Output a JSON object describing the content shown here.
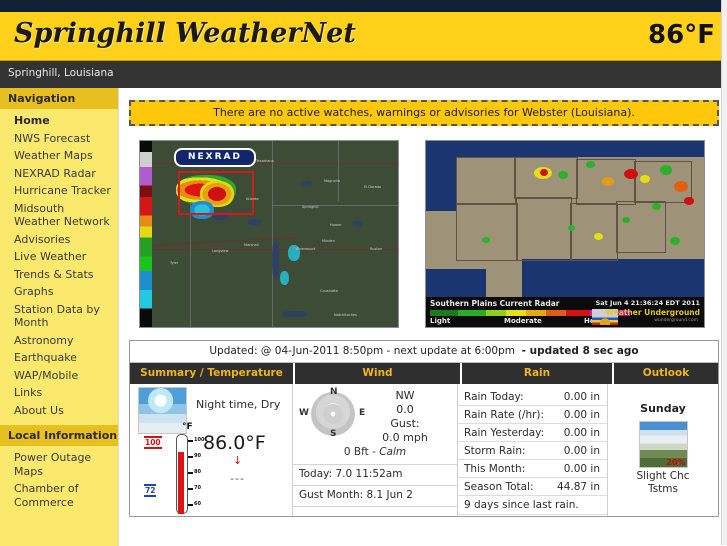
{
  "header": {
    "site_title": "Springhill WeatherNet",
    "current_temp": "86°F",
    "location": "Springhill, Louisiana"
  },
  "sidebar": {
    "nav_heading": "Navigation",
    "items": [
      {
        "label": "Home",
        "active": true
      },
      {
        "label": "NWS Forecast",
        "active": false
      },
      {
        "label": "Weather Maps",
        "active": false
      },
      {
        "label": "NEXRAD Radar",
        "active": false
      },
      {
        "label": "Hurricane Tracker",
        "active": false
      },
      {
        "label": "Midsouth Weather Network",
        "active": false
      },
      {
        "label": "Advisories",
        "active": false
      },
      {
        "label": "Live Weather",
        "active": false
      },
      {
        "label": "Trends & Stats",
        "active": false
      },
      {
        "label": "Graphs",
        "active": false
      },
      {
        "label": "Station Data by Month",
        "active": false
      },
      {
        "label": "Astronomy",
        "active": false
      },
      {
        "label": "Earthquake",
        "active": false
      },
      {
        "label": "WAP/Mobile",
        "active": false
      },
      {
        "label": "Links",
        "active": false
      },
      {
        "label": "About Us",
        "active": false
      }
    ],
    "local_heading": "Local Information",
    "local_items": [
      {
        "label": "Power Outage Maps"
      },
      {
        "label": "Chamber of Commerce"
      }
    ]
  },
  "alert": {
    "text": "There are no active watches, warnings or advisories for Webster (Louisiana)."
  },
  "radar_left": {
    "logo": "NEXRAD",
    "cities": [
      "Texarkana",
      "Magnolia",
      "El Dorado",
      "Atlanta",
      "Springhill",
      "Homer",
      "Minden",
      "Ruston",
      "Longview",
      "Marshall",
      "Shreveport",
      "Coushatta",
      "Tyler",
      "Natchitoches"
    ]
  },
  "radar_right": {
    "title": "Southern Plains Current Radar",
    "timestamp": "Sat Jun  4 21:36:24 EDT 2011",
    "brand": "Weather Underground",
    "brand_sub": "wunderground.com",
    "legend": [
      "Light",
      "Moderate",
      "Heavy"
    ]
  },
  "dashboard": {
    "updated_prefix": "Updated: @ 04-Jun-2011 8:50pm - next update at 6:00pm",
    "updated_suffix": "- updated 8 sec ago",
    "headers": {
      "summary": "Summary / Temperature",
      "wind": "Wind",
      "rain": "Rain",
      "outlook": "Outlook"
    },
    "summary": {
      "condition": "Night time, Dry",
      "temperature": "86.0°F",
      "trend_arrow": "↓",
      "dewpoint_placeholder": "---",
      "thermometer": {
        "unit": "°F",
        "high": "100",
        "low": "72",
        "ticks": [
          "100",
          "90",
          "80",
          "70",
          "60"
        ]
      }
    },
    "wind": {
      "compass": {
        "n": "N",
        "e": "E",
        "s": "S",
        "w": "W"
      },
      "direction": "NW",
      "speed": "0.0",
      "gust_label": "Gust:",
      "gust_value": "0.0 mph",
      "beaufort": "0 Bft - ",
      "beaufort_desc": "Calm",
      "today": "Today: 7.0 11:52am",
      "gust_month": "Gust Month: 8.1 Jun 2"
    },
    "rain": {
      "rows": [
        {
          "label": "Rain Today:",
          "value": "0.00 in"
        },
        {
          "label": "Rain Rate (/hr):",
          "value": "0.00 in"
        },
        {
          "label": "Rain Yesterday:",
          "value": "0.00 in"
        },
        {
          "label": "Storm Rain:",
          "value": "0.00 in"
        },
        {
          "label": "This Month:",
          "value": "0.00 in"
        },
        {
          "label": "Season Total:",
          "value": "44.87 in"
        }
      ],
      "note": "9 days since last rain."
    },
    "outlook": {
      "day": "Sunday",
      "pop": "20%",
      "text_line1": "Slight Chc",
      "text_line2": "Tstms"
    }
  },
  "colors": {
    "banner_yellow": "#ffd11a",
    "sidebar_yellow": "#fbe96e",
    "nav_header_gold": "#e8bf21",
    "alert_gold": "#ffc80a",
    "dark_navy": "#0d2236",
    "dark_gray": "#333333",
    "header_accent": "#f0b41c"
  }
}
